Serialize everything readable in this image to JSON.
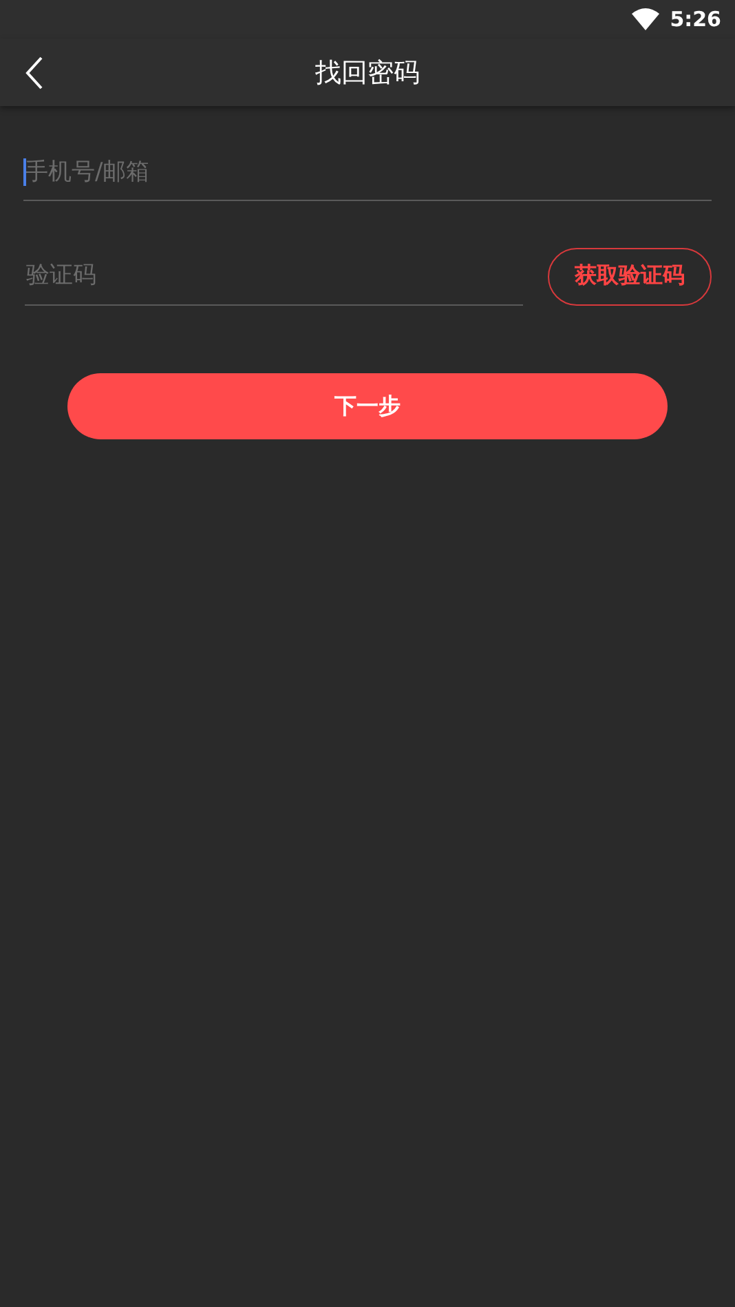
{
  "status_bar": {
    "time": "5:26"
  },
  "app_bar": {
    "title": "找回密码"
  },
  "account_field": {
    "placeholder": "手机号/邮箱",
    "focused": true
  },
  "code_field": {
    "placeholder": "验证码"
  },
  "get_code_button": {
    "label": "获取验证码"
  },
  "next_button": {
    "label": "下一步"
  }
}
